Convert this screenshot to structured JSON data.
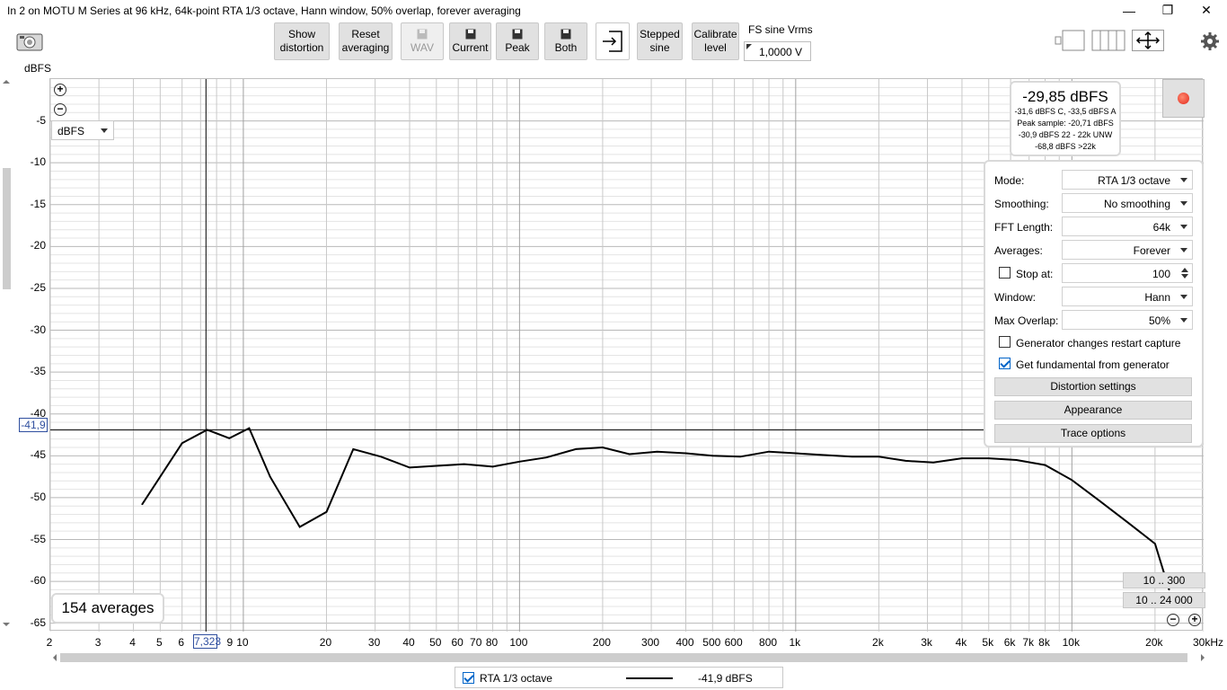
{
  "window": {
    "title": "In 2 on MOTU M Series at 96 kHz, 64k-point RTA 1/3 octave, Hann window, 50% overlap, forever averaging",
    "controls": {
      "minimize": "—",
      "restore": "❐",
      "close": "✕"
    }
  },
  "toolbar": {
    "show_distortion": [
      "Show",
      "distortion"
    ],
    "reset_averaging": [
      "Reset",
      "averaging"
    ],
    "wav": "WAV",
    "current": "Current",
    "peak": "Peak",
    "both": "Both",
    "stepped_sine": [
      "Stepped",
      "sine"
    ],
    "calibrate_level": [
      "Calibrate",
      "level"
    ],
    "fs_sine_label": "FS sine Vrms",
    "fs_sine_value": "1,0000 V"
  },
  "plot": {
    "y_unit_label": "dBFS",
    "y_unit_select": "dBFS",
    "x_unit_label": "30kHz",
    "y_marker": "-41,9",
    "x_marker": "7,323",
    "averages_count": "154 averages",
    "range_buttons": [
      "10 .. 300",
      "10 .. 24 000"
    ]
  },
  "level_meter": {
    "main": "-29,85 dBFS",
    "lines": [
      "-31,6 dBFS C, -33,5 dBFS A",
      "Peak sample: -20,71 dBFS",
      "-30,9 dBFS 22 - 22k UNW",
      "-68,8 dBFS >22k"
    ]
  },
  "settings_panel": {
    "mode": {
      "label": "Mode:",
      "value": "RTA 1/3 octave"
    },
    "smoothing": {
      "label": "Smoothing:",
      "value": "No smoothing"
    },
    "fft_length": {
      "label": "FFT Length:",
      "value": "64k"
    },
    "averages": {
      "label": "Averages:",
      "value": "Forever"
    },
    "stop_at": {
      "label": "Stop at:",
      "value": "100",
      "checked": false
    },
    "window": {
      "label": "Window:",
      "value": "Hann"
    },
    "max_overlap": {
      "label": "Max Overlap:",
      "value": "50%"
    },
    "gen_restart": {
      "label": "Generator changes restart capture",
      "checked": false
    },
    "get_fundamental": {
      "label": "Get fundamental from generator",
      "checked": true
    },
    "distortion_settings": "Distortion settings",
    "appearance": "Appearance",
    "trace_options": "Trace options"
  },
  "legend": {
    "trace_name": "RTA 1/3 octave",
    "trace_value": "-41,9 dBFS",
    "checked": true
  },
  "chart_data": {
    "type": "line",
    "xscale": "log",
    "xlim": [
      2,
      30000
    ],
    "ylim": [
      -66,
      0
    ],
    "ylabel": "dBFS",
    "xlabel": "",
    "grid": true,
    "y_ticks": [
      -5,
      -10,
      -15,
      -20,
      -25,
      -30,
      -35,
      -40,
      -45,
      -50,
      -55,
      -60,
      -65
    ],
    "y_tick_labels": [
      "-5",
      "-10",
      "-15",
      "-20",
      "-25",
      "-30",
      "-35",
      "-40",
      "-45",
      "-50",
      "-55",
      "-60",
      "-65"
    ],
    "x_ticks": [
      2,
      3,
      4,
      5,
      6,
      9,
      10,
      20,
      30,
      40,
      50,
      60,
      70,
      80,
      100,
      200,
      300,
      400,
      500,
      600,
      800,
      1000,
      2000,
      3000,
      4000,
      5000,
      6000,
      7000,
      8000,
      10000,
      20000
    ],
    "x_tick_labels": [
      "2",
      "3",
      "4",
      "5",
      "6",
      "9",
      "10",
      "20",
      "30",
      "40",
      "50",
      "60",
      "70",
      "80",
      "100",
      "200",
      "300",
      "400",
      "500",
      "600",
      "800",
      "1k",
      "2k",
      "3k",
      "4k",
      "5k",
      "6k",
      "7k",
      "8k",
      "10k",
      "20k"
    ],
    "cursor": {
      "x": 7.323,
      "y": -41.9
    },
    "series": [
      {
        "color": "#000000",
        "x": [
          4.3,
          6.0,
          7.4,
          8.9,
          10.5,
          12.5,
          16,
          20,
          25,
          31.5,
          40,
          50,
          63,
          80,
          100,
          125,
          160,
          200,
          250,
          315,
          400,
          500,
          630,
          800,
          1000,
          1250,
          1600,
          2000,
          2500,
          3150,
          4000,
          5000,
          6300,
          8000,
          10000,
          12500,
          16000,
          20000,
          22500
        ],
        "y": [
          -50.8,
          -43.5,
          -41.9,
          -42.9,
          -41.7,
          -47.5,
          -53.5,
          -51.7,
          -44.2,
          -45.1,
          -46.4,
          -46.2,
          -46.0,
          -46.3,
          -45.7,
          -45.2,
          -44.2,
          -44.0,
          -44.8,
          -44.5,
          -44.7,
          -45.0,
          -45.1,
          -44.5,
          -44.7,
          -44.9,
          -45.1,
          -45.1,
          -45.6,
          -45.8,
          -45.3,
          -45.3,
          -45.5,
          -46.1,
          -47.9,
          -50.3,
          -53.0,
          -55.5,
          -61.0
        ]
      }
    ]
  }
}
